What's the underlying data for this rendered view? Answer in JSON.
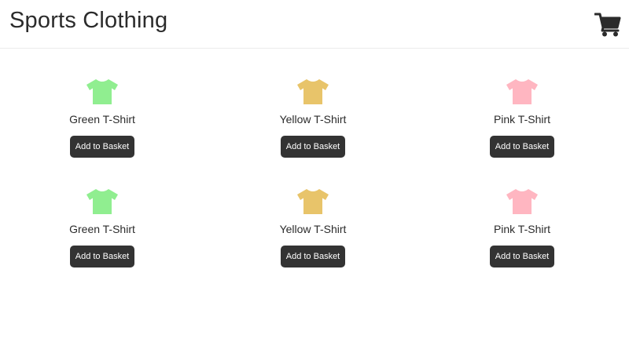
{
  "header": {
    "title": "Sports Clothing",
    "cart_icon": "shopping-cart-icon"
  },
  "products": [
    {
      "name": "Green T-Shirt",
      "color": "#90ee90",
      "button_label": "Add to Basket",
      "icon": "t-shirt-icon"
    },
    {
      "name": "Yellow T-Shirt",
      "color": "#e8c46a",
      "button_label": "Add to Basket",
      "icon": "t-shirt-icon"
    },
    {
      "name": "Pink T-Shirt",
      "color": "#ffb6c1",
      "button_label": "Add to Basket",
      "icon": "t-shirt-icon"
    },
    {
      "name": "Green T-Shirt",
      "color": "#90ee90",
      "button_label": "Add to Basket",
      "icon": "t-shirt-icon"
    },
    {
      "name": "Yellow T-Shirt",
      "color": "#e8c46a",
      "button_label": "Add to Basket",
      "icon": "t-shirt-icon"
    },
    {
      "name": "Pink T-Shirt",
      "color": "#ffb6c1",
      "button_label": "Add to Basket",
      "icon": "t-shirt-icon"
    }
  ]
}
